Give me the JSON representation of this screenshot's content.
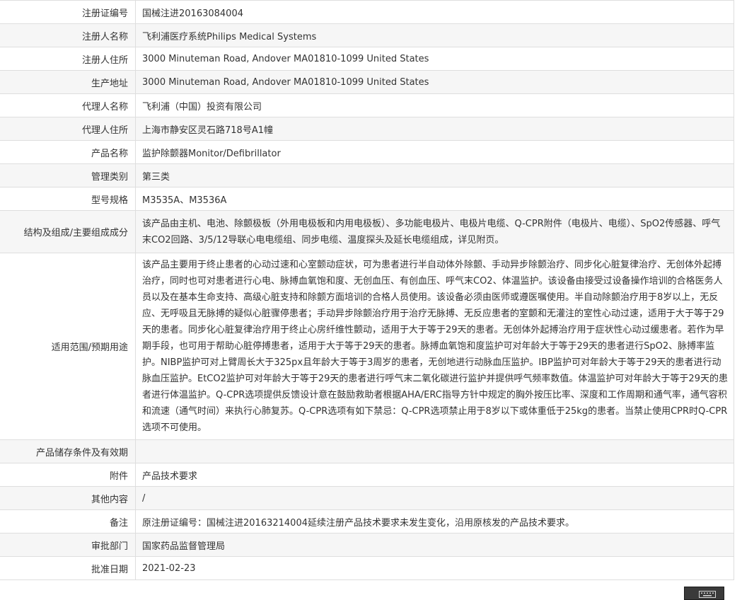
{
  "rows": [
    {
      "label": "注册证编号",
      "value": "国械注进20163084004"
    },
    {
      "label": "注册人名称",
      "value": "飞利浦医疗系统Philips Medical Systems"
    },
    {
      "label": "注册人住所",
      "value": "3000 Minuteman Road, Andover MA01810-1099 United States"
    },
    {
      "label": "生产地址",
      "value": "3000 Minuteman Road, Andover MA01810-1099 United States"
    },
    {
      "label": "代理人名称",
      "value": "飞利浦（中国）投资有限公司"
    },
    {
      "label": "代理人住所",
      "value": "上海市静安区灵石路718号A1幢"
    },
    {
      "label": "产品名称",
      "value": "监护除颤器Monitor/Defibrillator"
    },
    {
      "label": "管理类别",
      "value": "第三类"
    },
    {
      "label": "型号规格",
      "value": "M3535A、M3536A"
    },
    {
      "label": "结构及组成/主要组成成分",
      "value": "该产品由主机、电池、除颤极板（外用电极板和内用电极板）、多功能电极片、电极片电缆、Q-CPR附件（电极片、电缆）、SpO2传感器、呼气末CO2回路、3/5/12导联心电电缆组、同步电缆、温度探头及延长电缆组成，详见附页。"
    },
    {
      "label": "适用范围/预期用途",
      "value": "该产品主要用于终止患者的心动过速和心室颤动症状，可为患者进行半自动体外除颤、手动异步除颤治疗、同步化心脏复律治疗、无创体外起搏治疗，同时也可对患者进行心电、脉搏血氧饱和度、无创血压、有创血压、呼气末CO2、体温监护。该设备由接受过设备操作培训的合格医务人员以及在基本生命支持、高级心脏支持和除颤方面培训的合格人员使用。该设备必须由医师或遵医嘱使用。半自动除颤治疗用于8岁以上，无反应、无呼吸且无脉搏的疑似心脏骤停患者；手动异步除颤治疗用于治疗无脉搏、无反应患者的室颤和无灌注的室性心动过速，适用于大于等于29天的患者。同步化心脏复律治疗用于终止心房纤维性颤动，适用于大于等于29天的患者。无创体外起搏治疗用于症状性心动过缓患者。若作为早期手段，也可用于帮助心脏停搏患者，适用于大于等于29天的患者。脉搏血氧饱和度监护可对年龄大于等于29天的患者进行SpO2、脉搏率监护。NIBP监护可对上臂周长大于325px且年龄大于等于3周岁的患者，无创地进行动脉血压监护。IBP监护可对年龄大于等于29天的患者进行动脉血压监护。EtCO2监护可对年龄大于等于29天的患者进行呼气末二氧化碳进行监护并提供呼气频率数值。体温监护可对年龄大于等于29天的患者进行体温监护。Q-CPR选项提供反馈设计意在鼓励救助者根据AHA/ERC指导方针中规定的胸外按压比率、深度和工作周期和通气率，通气容积和流速（通气时间）来执行心肺复苏。Q-CPR选项有如下禁忌：Q-CPR选项禁止用于8岁以下或体重低于25kg的患者。当禁止使用CPR时Q-CPR选项不可使用。"
    },
    {
      "label": "产品储存条件及有效期",
      "value": ""
    },
    {
      "label": "附件",
      "value": "产品技术要求"
    },
    {
      "label": "其他内容",
      "value": "/"
    },
    {
      "label": "备注",
      "value": "原注册证编号：国械注进20163214004延续注册产品技术要求未发生变化，沿用原核发的产品技术要求。"
    },
    {
      "label": "审批部门",
      "value": "国家药品监督管理局"
    },
    {
      "label": "批准日期",
      "value": "2021-02-23"
    }
  ],
  "widgets": {
    "keyboard_icon": "keyboard-icon",
    "keyboard_bg": "#3a3a3a"
  }
}
